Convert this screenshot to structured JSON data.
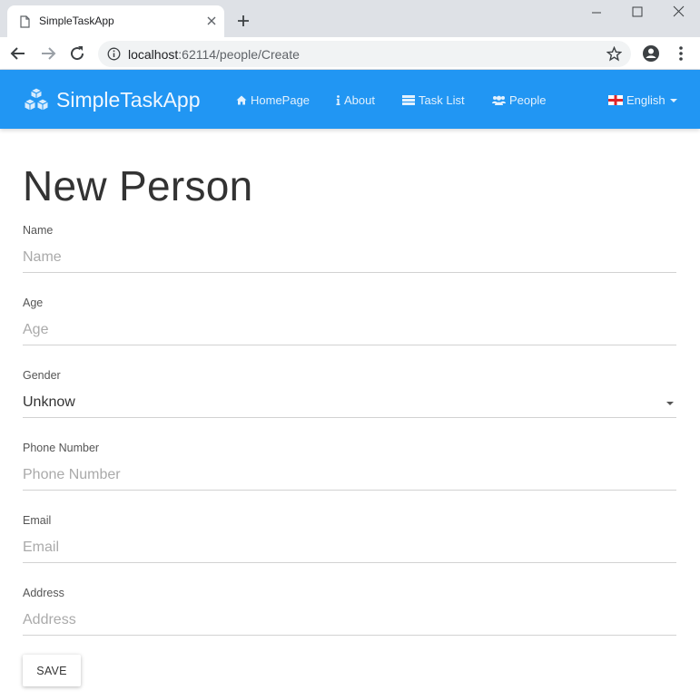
{
  "browser": {
    "tab_title": "SimpleTaskApp",
    "url_host": "localhost",
    "url_path": ":62114/people/Create"
  },
  "navbar": {
    "brand": "SimpleTaskApp",
    "items": [
      {
        "label": "HomePage",
        "icon": "home-icon"
      },
      {
        "label": "About",
        "icon": "info-icon"
      },
      {
        "label": "Task List",
        "icon": "list-icon"
      },
      {
        "label": "People",
        "icon": "users-icon"
      }
    ],
    "language": {
      "label": "English",
      "icon": "england-flag-icon"
    }
  },
  "colors": {
    "navbar": "#2196f3",
    "tabstrip": "#dee1e6"
  },
  "form": {
    "title": "New Person",
    "fields": [
      {
        "label": "Name",
        "placeholder": "Name"
      },
      {
        "label": "Age",
        "placeholder": "Age"
      },
      {
        "label": "Gender",
        "value": "Unknow"
      },
      {
        "label": "Phone Number",
        "placeholder": "Phone Number"
      },
      {
        "label": "Email",
        "placeholder": "Email"
      },
      {
        "label": "Address",
        "placeholder": "Address"
      }
    ],
    "save_label": "SAVE"
  }
}
